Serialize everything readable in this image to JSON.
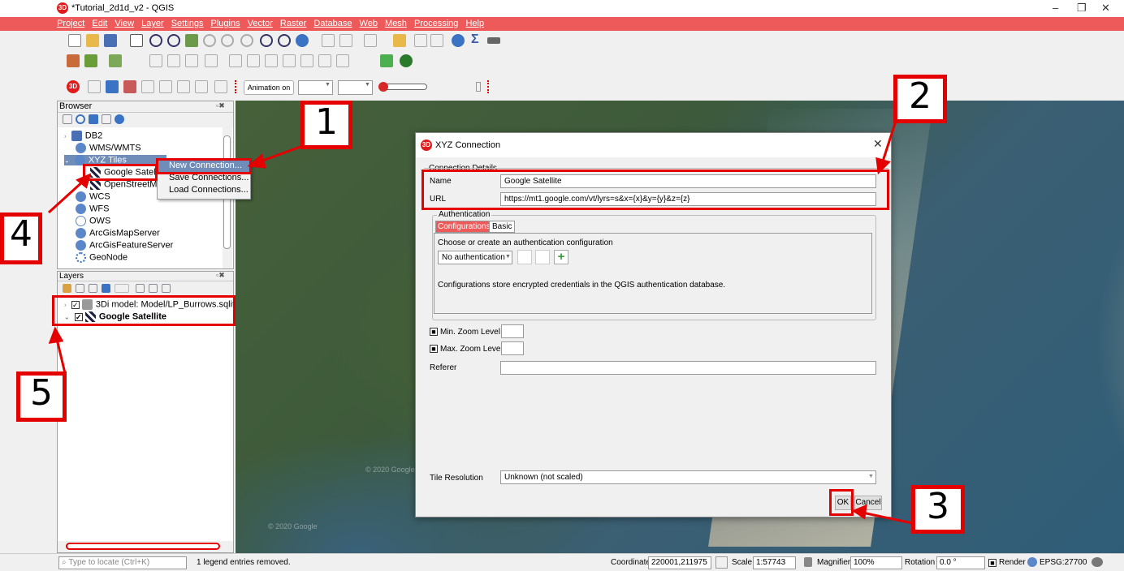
{
  "window": {
    "title": "*Tutorial_2d1d_v2 - QGIS",
    "controls": [
      "–",
      "❐",
      "✕"
    ]
  },
  "menu": [
    "Project",
    "Edit",
    "View",
    "Layer",
    "Settings",
    "Plugins",
    "Vector",
    "Raster",
    "Database",
    "Web",
    "Mesh",
    "Processing",
    "Help"
  ],
  "toolbar3": {
    "animation_label": "Animation on"
  },
  "browser": {
    "title": "Browser",
    "items": [
      {
        "label": "DB2",
        "icon": "db2-icon"
      },
      {
        "label": "WMS/WMTS",
        "icon": "globe-icon"
      },
      {
        "label": "XYZ Tiles",
        "icon": "globe-icon"
      },
      {
        "label": "Google Satelli",
        "icon": "tiles-icon"
      },
      {
        "label": "OpenStreetMa",
        "icon": "tiles-icon"
      },
      {
        "label": "WCS",
        "icon": "globe-icon"
      },
      {
        "label": "WFS",
        "icon": "globe-icon"
      },
      {
        "label": "OWS",
        "icon": "globe-icon"
      },
      {
        "label": "ArcGisMapServer",
        "icon": "globe-icon"
      },
      {
        "label": "ArcGisFeatureServer",
        "icon": "globe-icon"
      },
      {
        "label": "GeoNode",
        "icon": "geonode-icon"
      }
    ]
  },
  "context_menu": [
    "New Connection...",
    "Save Connections...",
    "Load Connections..."
  ],
  "layers": {
    "title": "Layers",
    "items": [
      {
        "label": "3Di model: Model/LP_Burrows.sqlit",
        "checked": "✓"
      },
      {
        "label": "Google Satellite",
        "checked": "✓"
      }
    ]
  },
  "dialog": {
    "title": "XYZ Connection",
    "group": "Connection Details",
    "name_label": "Name",
    "name_value": "Google Satellite",
    "url_label": "URL",
    "url_value": "https://mt1.google.com/vt/lyrs=s&x={x}&y={y}&z={z}",
    "auth_group": "Authentication",
    "tabs": [
      "Configurations",
      "Basic"
    ],
    "auth_prompt": "Choose or create an authentication configuration",
    "auth_select": "No authentication",
    "auth_note": "Configurations store encrypted credentials in the QGIS authentication database.",
    "min_zoom_label": "Min. Zoom Level",
    "max_zoom_label": "Max. Zoom Level",
    "referer_label": "Referer",
    "tile_res_label": "Tile Resolution",
    "tile_res_value": "Unknown (not scaled)",
    "ok": "OK",
    "cancel": "Cancel"
  },
  "callouts": [
    "1",
    "2",
    "3",
    "4",
    "5"
  ],
  "map_labels": [
    "© 2020 Google",
    "© 2020 Google"
  ],
  "statusbar": {
    "locate_placeholder": "Type to locate (Ctrl+K)",
    "message": "1 legend entries removed.",
    "coordinate_label": "Coordinate",
    "coordinate": "220001,211975",
    "scale_label": "Scale",
    "scale": "1:57743",
    "magnifier_label": "Magnifier",
    "magnifier": "100%",
    "rotation_label": "Rotation",
    "rotation": "0.0 °",
    "render_label": "Render",
    "epsg": "EPSG:27700"
  },
  "colors": {
    "accent": "#ee5a5a",
    "annotation": "#e50000"
  }
}
